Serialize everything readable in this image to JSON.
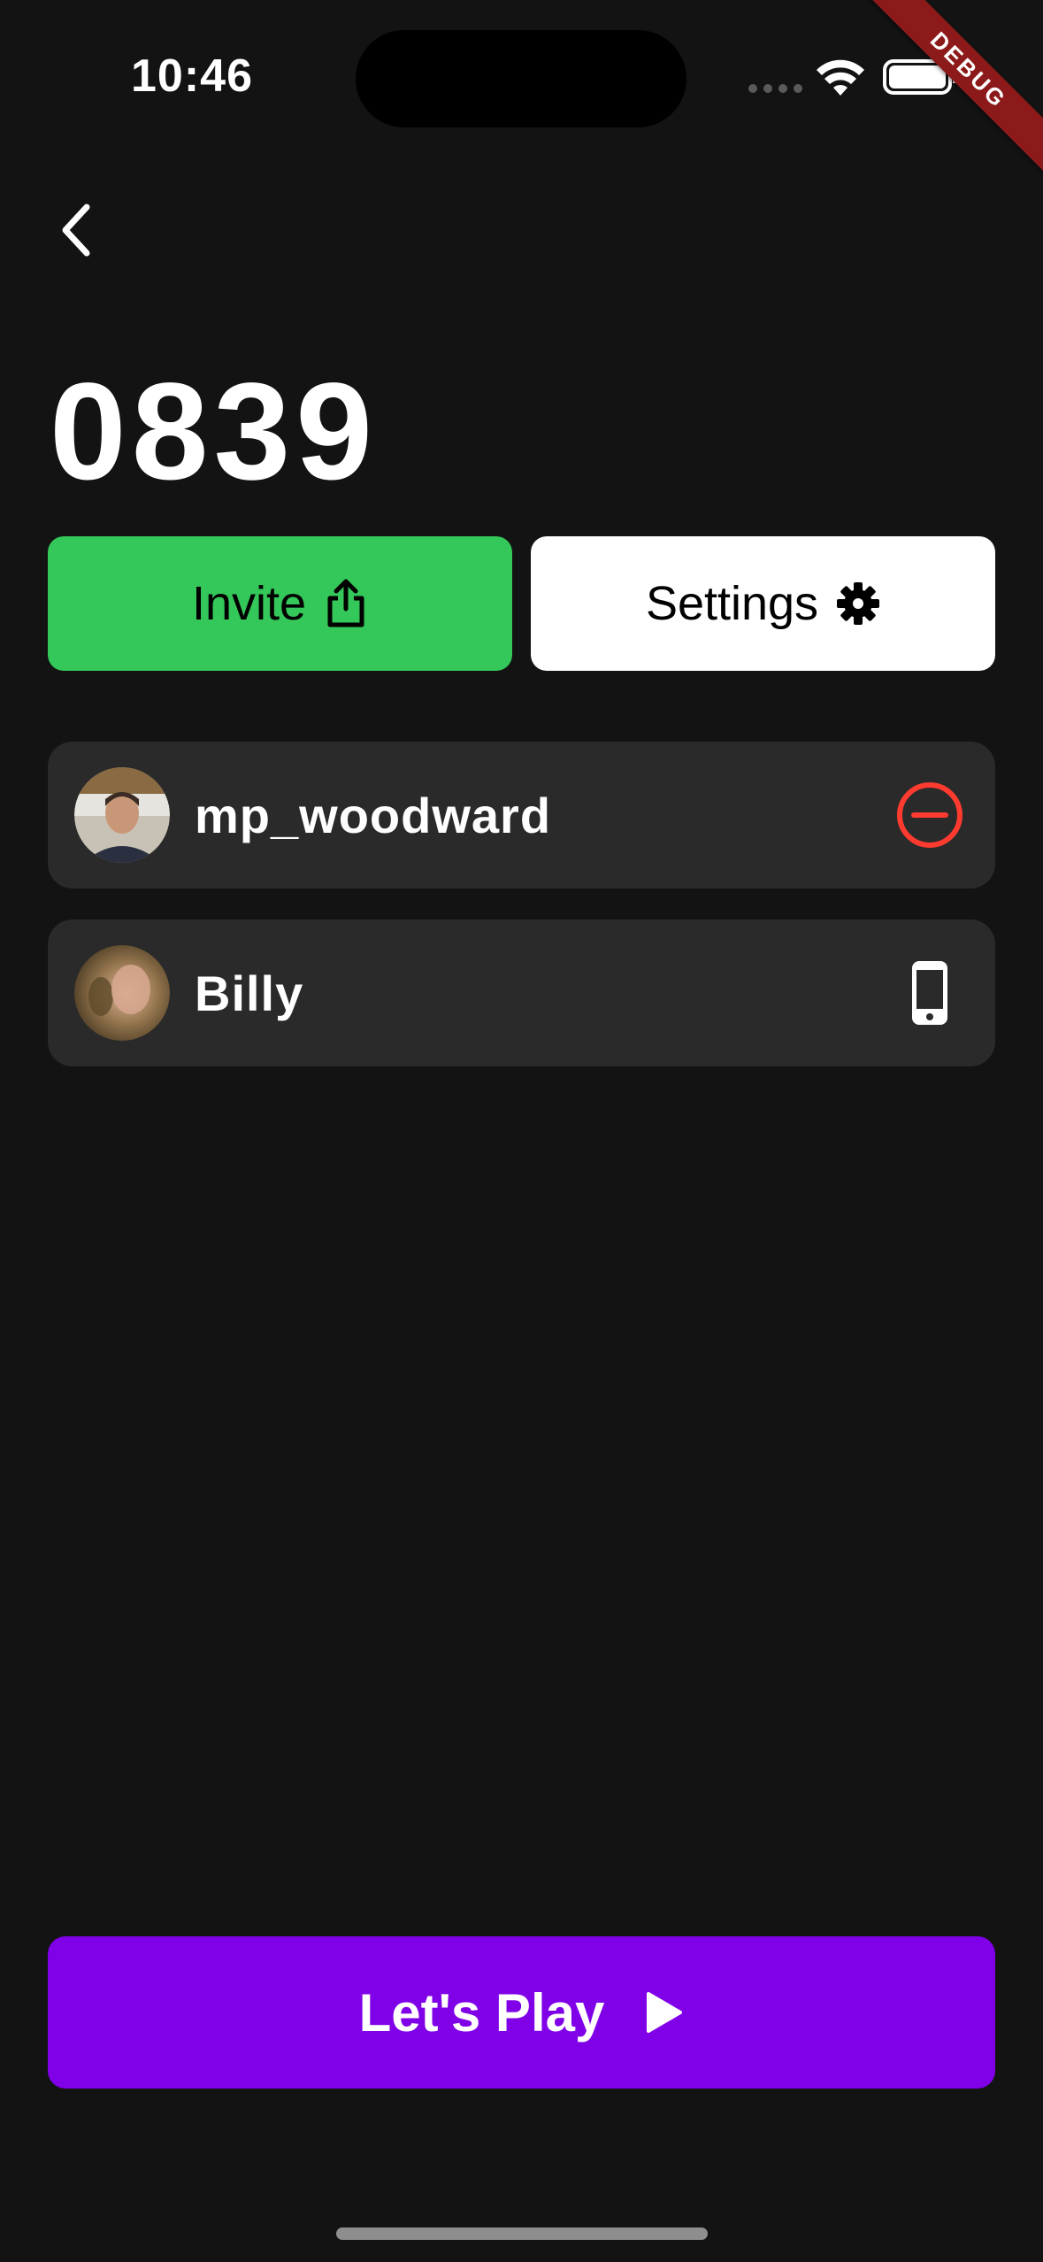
{
  "status_bar": {
    "time": "10:46"
  },
  "debug_banner": {
    "label": "DEBUG"
  },
  "room": {
    "code": "0839"
  },
  "actions": {
    "invite_label": "Invite",
    "settings_label": "Settings"
  },
  "players": [
    {
      "name": "mp_woodward",
      "action_icon": "remove-circle-icon",
      "icon_color": "#ff3b30"
    },
    {
      "name": "Billy",
      "action_icon": "phone-icon",
      "icon_color": "#ffffff"
    }
  ],
  "play_button": {
    "label": "Let's Play"
  },
  "colors": {
    "background": "#131313",
    "invite": "#34c759",
    "settings": "#ffffff",
    "play": "#8000e8",
    "row": "#2a2a2a",
    "debug": "#8c1a1a"
  }
}
